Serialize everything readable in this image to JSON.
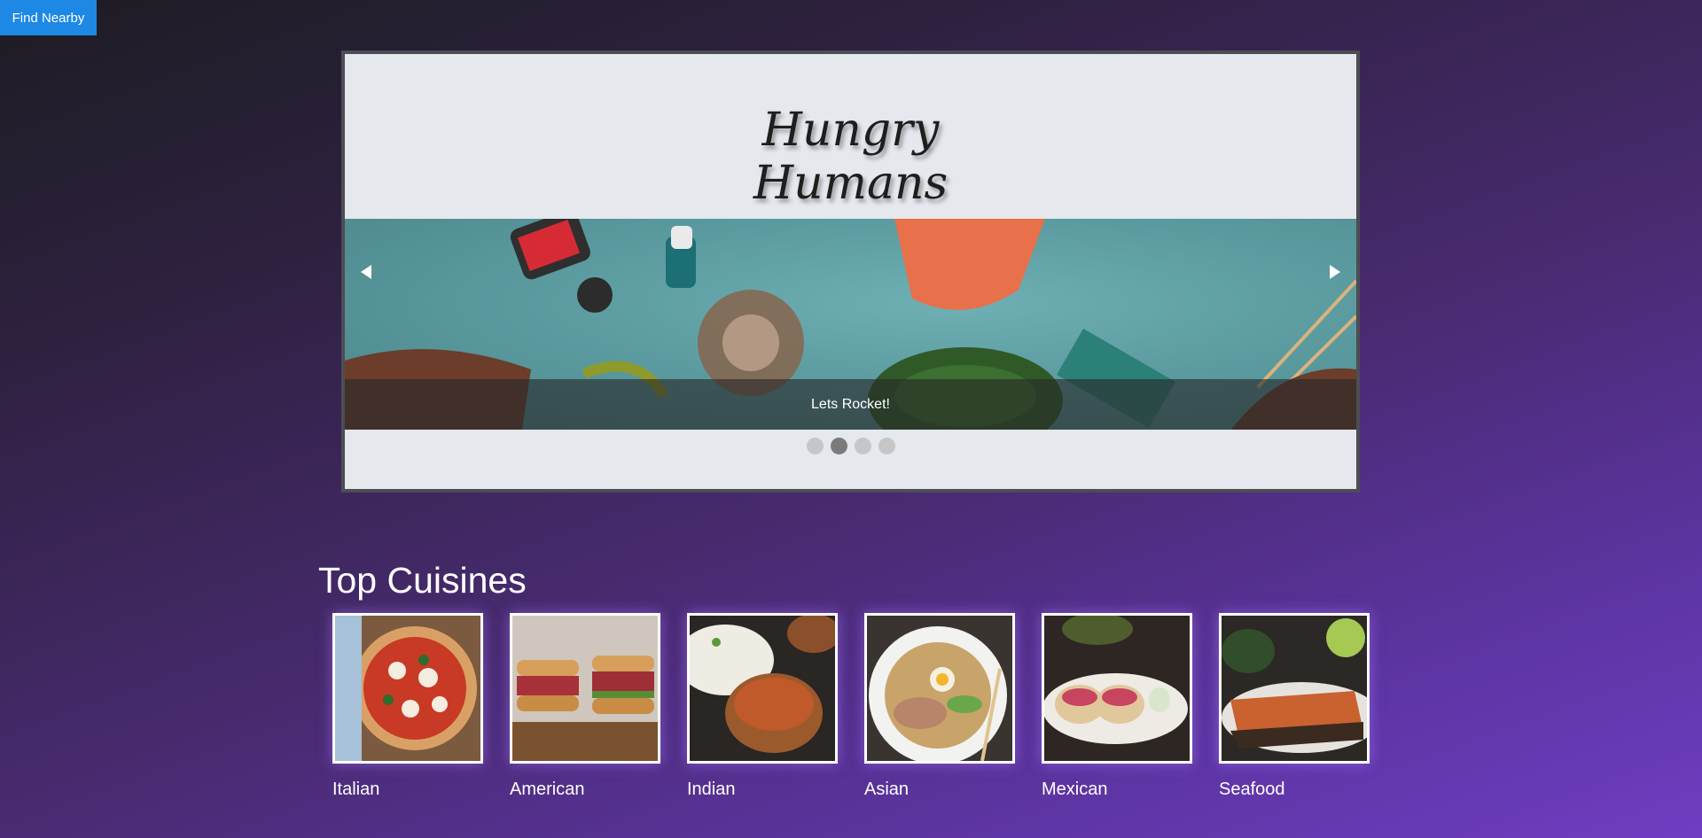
{
  "find_button": {
    "label": "Find Nearby"
  },
  "hero": {
    "title_line1": "Hungry",
    "title_line2": "Humans",
    "slide_caption": "Lets Rocket!",
    "active_slide": 2,
    "slide_count": 4
  },
  "section": {
    "title": "Top Cuisines"
  },
  "cuisines": [
    {
      "label": "Italian"
    },
    {
      "label": "American"
    },
    {
      "label": "Indian"
    },
    {
      "label": "Asian"
    },
    {
      "label": "Mexican"
    },
    {
      "label": "Seafood"
    }
  ],
  "colors": {
    "button_blue": "#1e88e5",
    "hero_bg": "#e5e8ed",
    "hero_border": "#4d4d55",
    "slide_teal": "#5d9aa0"
  },
  "icons": {
    "prev": "arrow-left-icon",
    "next": "arrow-right-icon"
  }
}
